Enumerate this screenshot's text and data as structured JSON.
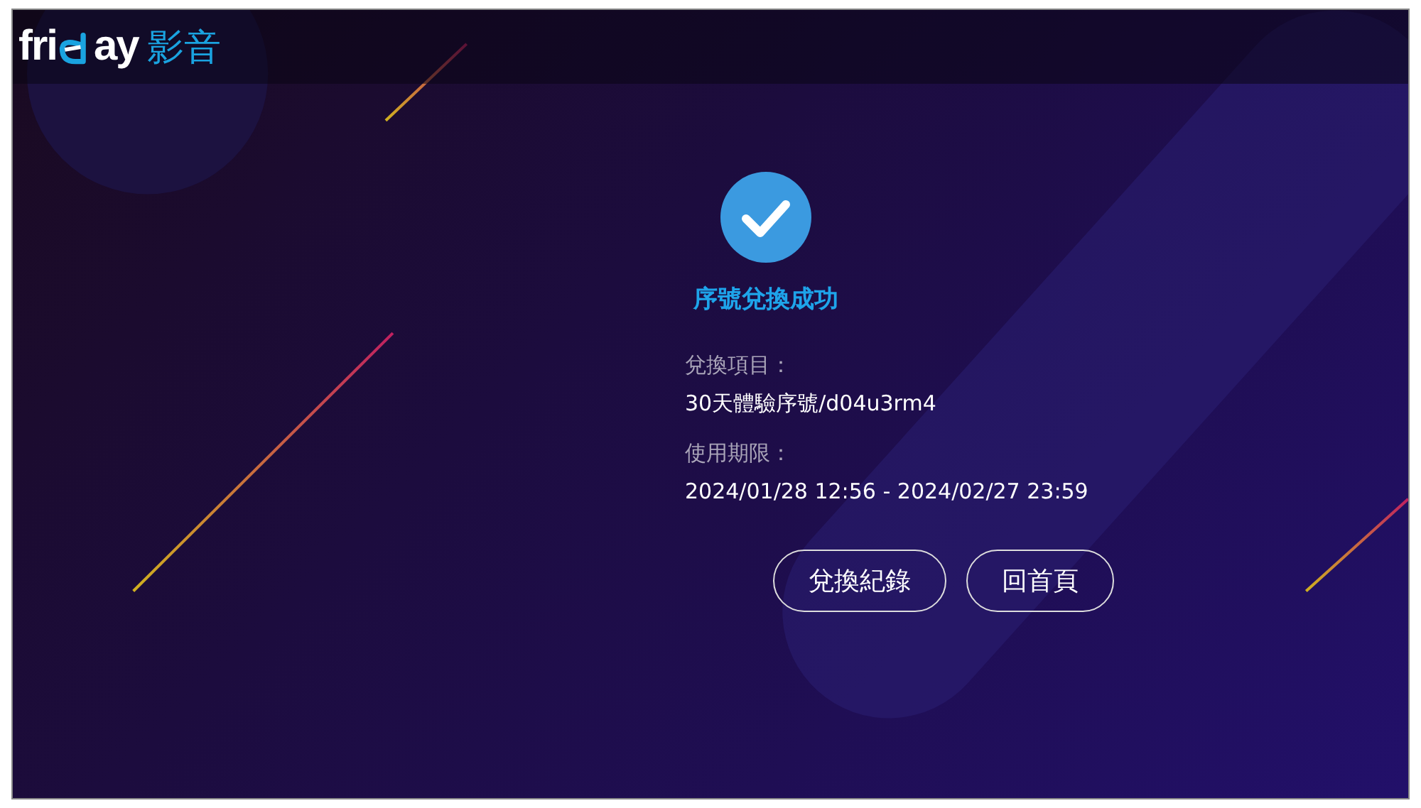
{
  "header": {
    "logo": {
      "part_1": "fri",
      "part_2": "ay",
      "label": "影音"
    }
  },
  "result": {
    "success": true,
    "title": "序號兌換成功"
  },
  "details": [
    {
      "label": "兌換項目：",
      "value": "30天體驗序號/d04u3rm4"
    },
    {
      "label": "使用期限：",
      "value": "2024/01/28 12:56 - 2024/02/27 23:59"
    }
  ],
  "buttons": [
    "兌換紀錄",
    "回首頁"
  ]
}
